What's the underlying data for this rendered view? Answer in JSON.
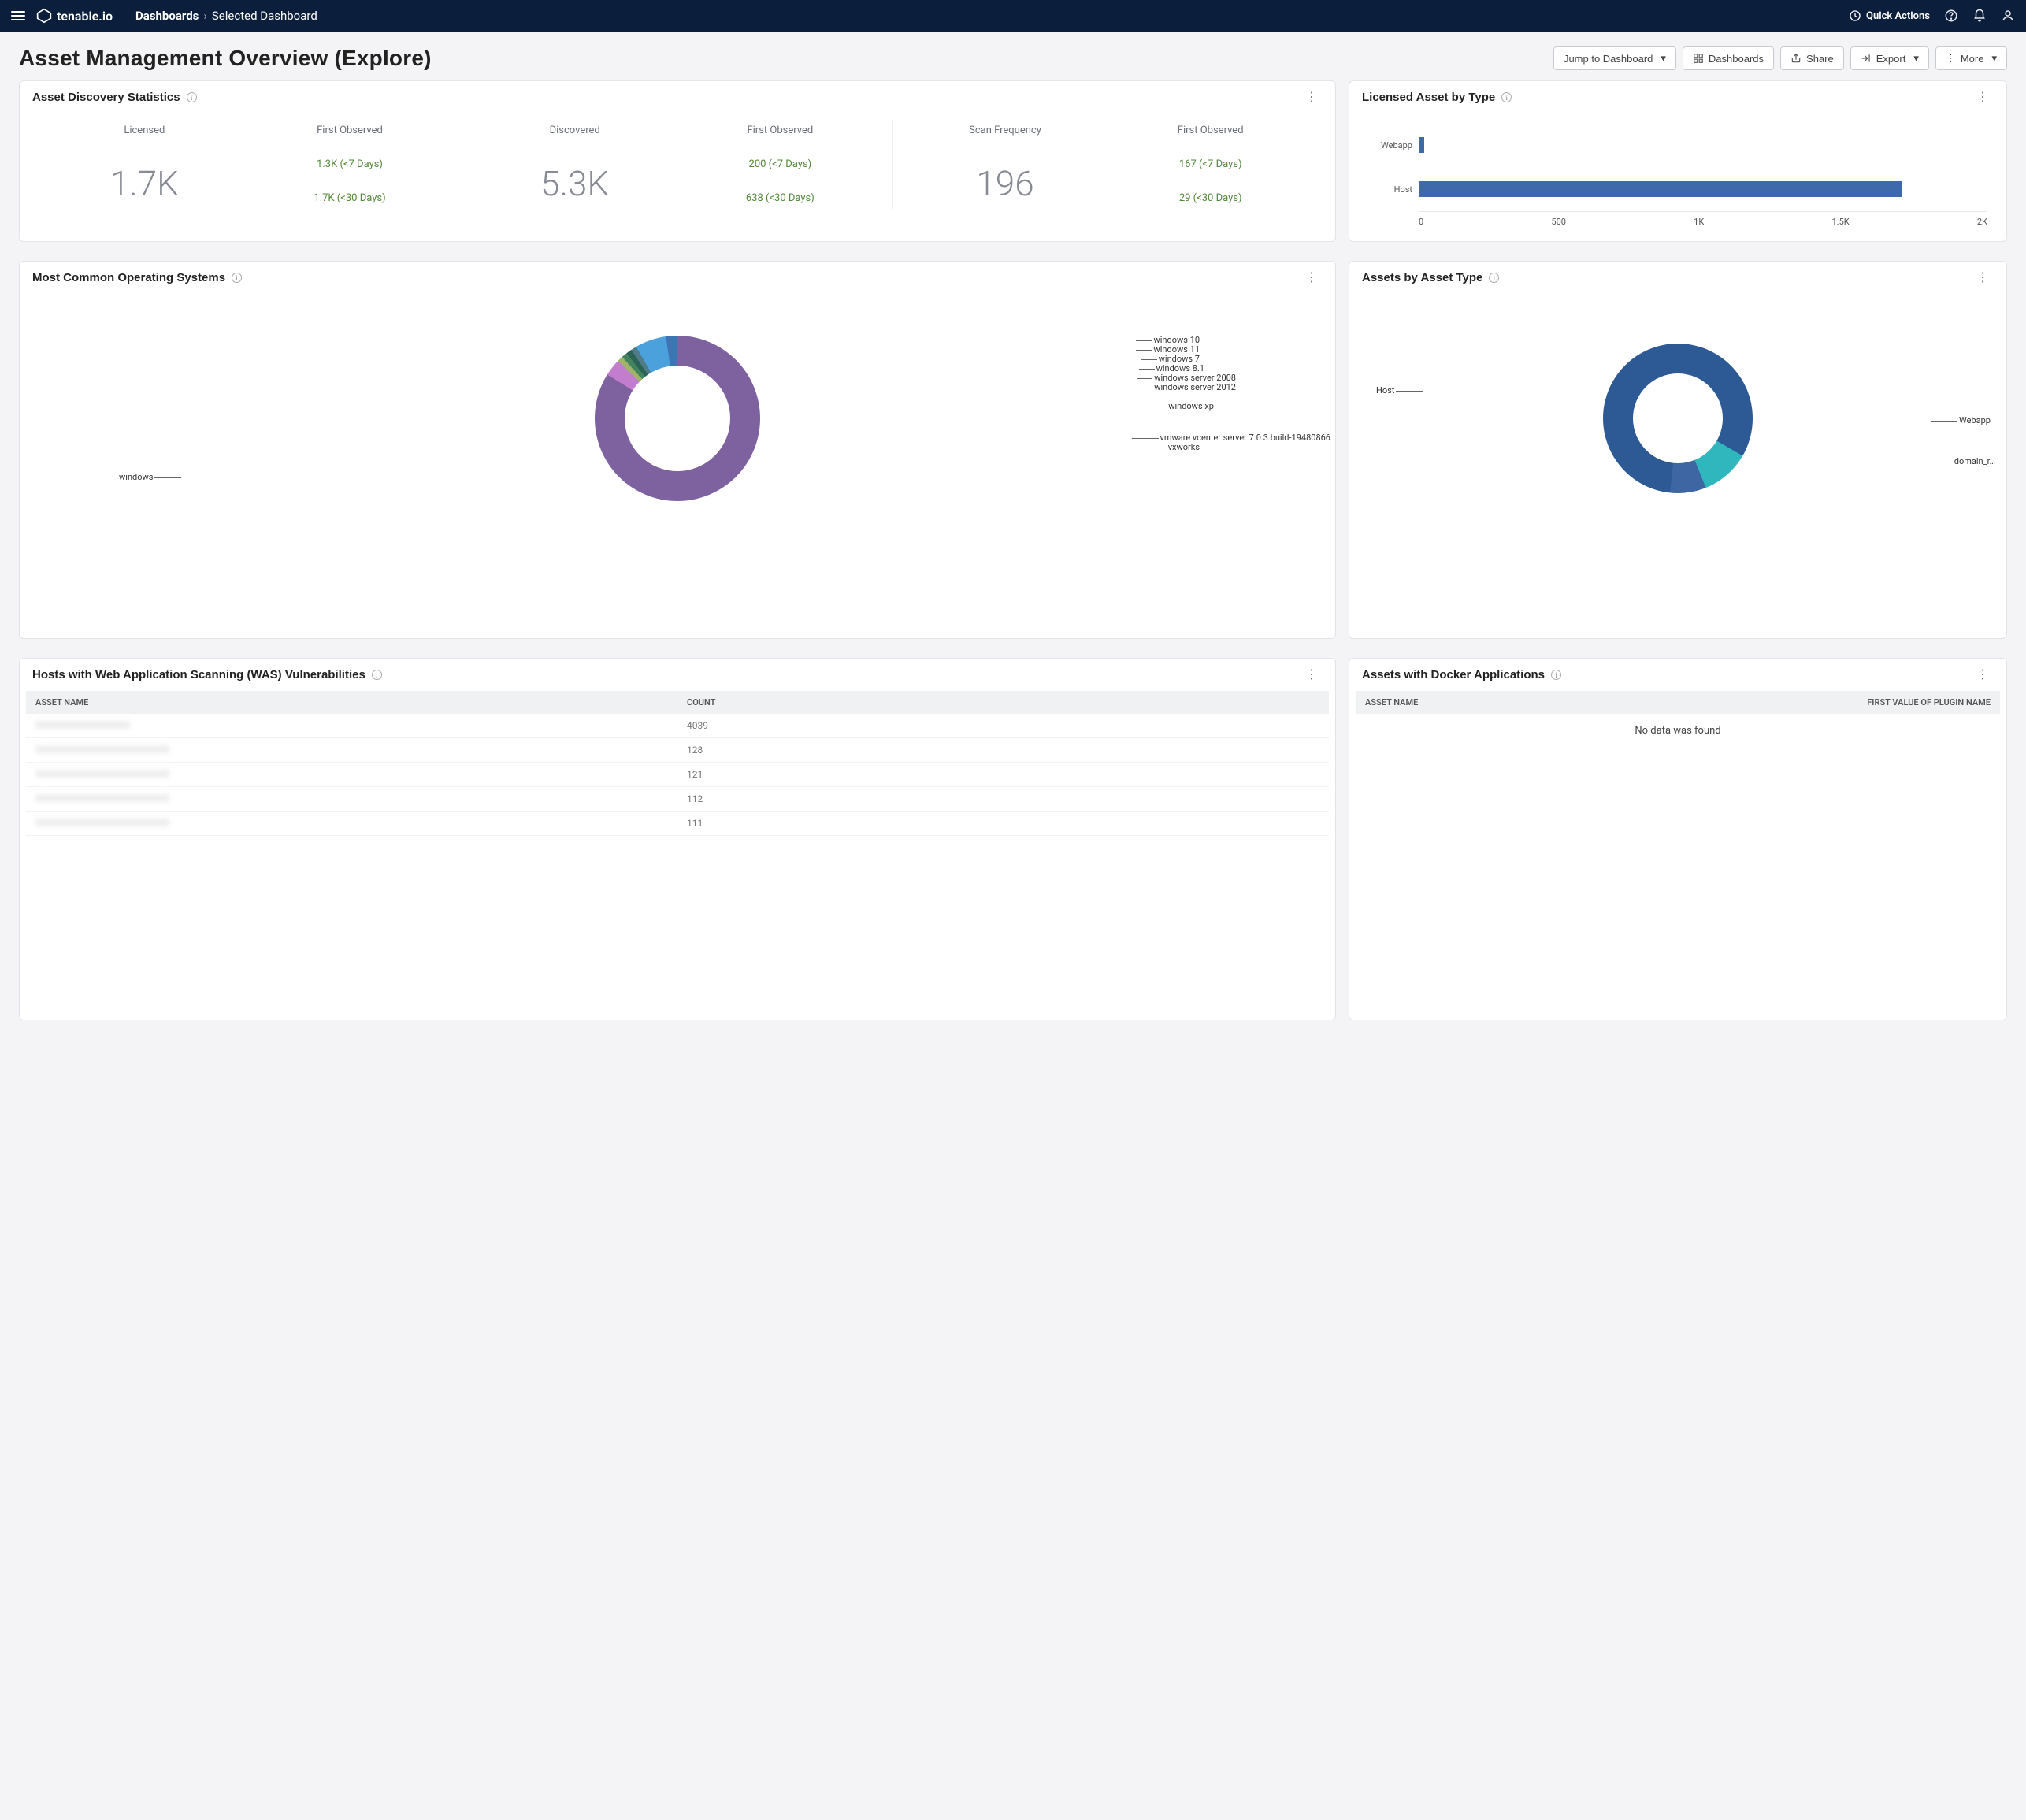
{
  "nav": {
    "brand": "tenable.io",
    "crumb_root": "Dashboards",
    "crumb_leaf": "Selected Dashboard",
    "quick_actions": "Quick Actions"
  },
  "page": {
    "title": "Asset Management Overview (Explore)",
    "actions": {
      "jump": "Jump to Dashboard",
      "dashboards": "Dashboards",
      "share": "Share",
      "export": "Export",
      "more": "More"
    }
  },
  "cards": {
    "discovery": {
      "title": "Asset Discovery Statistics",
      "groups": [
        {
          "big_label": "Licensed",
          "big_value": "1.7K",
          "sub_label": "First Observed",
          "line1": "1.3K (<7 Days)",
          "line2": "1.7K (<30 Days)"
        },
        {
          "big_label": "Discovered",
          "big_value": "5.3K",
          "sub_label": "First Observed",
          "line1": "200 (<7 Days)",
          "line2": "638 (<30 Days)"
        },
        {
          "big_label": "Scan Frequency",
          "big_value": "196",
          "sub_label": "First Observed",
          "line1": "167 (<7 Days)",
          "line2": "29 (<30 Days)"
        }
      ]
    },
    "licensed_type": {
      "title": "Licensed Asset by Type",
      "bars": [
        {
          "label": "Webapp",
          "value": 20
        },
        {
          "label": "Host",
          "value": 1700
        }
      ],
      "axis": [
        "0",
        "500",
        "1K",
        "1.5K",
        "2K"
      ],
      "max": 2000
    },
    "os": {
      "title": "Most Common Operating Systems",
      "labels": {
        "windows": "windows",
        "win10": "windows 10",
        "win11": "windows 11",
        "win7": "windows 7",
        "win81": "windows 8.1",
        "srv2008": "windows server 2008",
        "srv2012": "windows server 2012",
        "winxp": "windows xp",
        "vcenter": "vmware vcenter server 7.0.3 build-19480866",
        "vxworks": "vxworks"
      }
    },
    "asset_type": {
      "title": "Assets by Asset Type",
      "labels": {
        "host": "Host",
        "webapp": "Webapp",
        "domain": "domain_r…"
      }
    },
    "was": {
      "title": "Hosts with Web Application Scanning (WAS) Vulnerabilities",
      "cols": {
        "name": "ASSET NAME",
        "count": "COUNT"
      },
      "rows": [
        {
          "count": "4039"
        },
        {
          "count": "128"
        },
        {
          "count": "121"
        },
        {
          "count": "112"
        },
        {
          "count": "111"
        }
      ]
    },
    "docker": {
      "title": "Assets with Docker Applications",
      "cols": {
        "name": "ASSET NAME",
        "plugin": "FIRST VALUE OF PLUGIN NAME"
      },
      "empty": "No data was found"
    }
  },
  "chart_data": [
    {
      "type": "bar",
      "title": "Licensed Asset by Type",
      "orientation": "horizontal",
      "categories": [
        "Webapp",
        "Host"
      ],
      "values": [
        20,
        1700
      ],
      "xlabel": "",
      "ylabel": "",
      "xlim": [
        0,
        2000
      ],
      "xticks": [
        0,
        500,
        1000,
        1500,
        2000
      ]
    },
    {
      "type": "pie",
      "title": "Most Common Operating Systems",
      "hole": 0.65,
      "series": [
        {
          "name": "windows",
          "value": 83
        },
        {
          "name": "windows 10",
          "value": 3
        },
        {
          "name": "windows 11",
          "value": 1
        },
        {
          "name": "windows 7",
          "value": 1
        },
        {
          "name": "windows 8.1",
          "value": 1
        },
        {
          "name": "windows server 2008",
          "value": 1
        },
        {
          "name": "windows server 2012",
          "value": 1
        },
        {
          "name": "windows xp",
          "value": 6
        },
        {
          "name": "vmware vcenter server 7.0.3 build-19480866",
          "value": 1.5
        },
        {
          "name": "vxworks",
          "value": 1.5
        }
      ]
    },
    {
      "type": "pie",
      "title": "Assets by Asset Type",
      "hole": 0.65,
      "series": [
        {
          "name": "Host",
          "value": 82
        },
        {
          "name": "Webapp",
          "value": 10
        },
        {
          "name": "domain_r…",
          "value": 8
        }
      ]
    }
  ]
}
